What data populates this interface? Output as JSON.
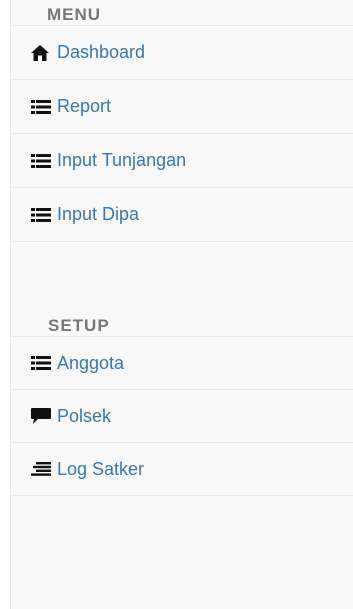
{
  "sidebar": {
    "menu_title": "MENU",
    "setup_title": "SETUP",
    "menu_items": [
      {
        "label": "Dashboard",
        "icon": "home-icon"
      },
      {
        "label": "Report",
        "icon": "list-icon"
      },
      {
        "label": "Input Tunjangan",
        "icon": "list-icon"
      },
      {
        "label": "Input Dipa",
        "icon": "list-icon"
      }
    ],
    "setup_items": [
      {
        "label": "Anggota",
        "icon": "list-icon"
      },
      {
        "label": "Polsek",
        "icon": "comment-icon"
      },
      {
        "label": "Log Satker",
        "icon": "align-right-icon"
      }
    ]
  },
  "colors": {
    "link": "#337ab7",
    "header": "#777777",
    "background": "#f8f8f8",
    "border": "#e7e7e7",
    "icon": "#111111"
  }
}
